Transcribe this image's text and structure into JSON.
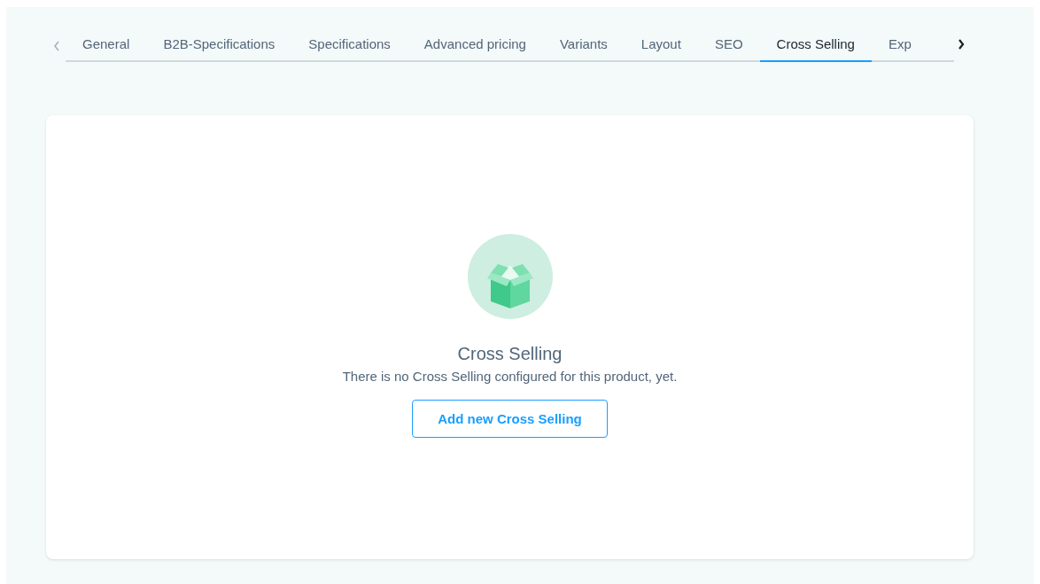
{
  "tabs": [
    {
      "label": "General",
      "selected": false
    },
    {
      "label": "B2B-Specifications",
      "selected": false
    },
    {
      "label": "Specifications",
      "selected": false
    },
    {
      "label": "Advanced pricing",
      "selected": false
    },
    {
      "label": "Variants",
      "selected": false
    },
    {
      "label": "Layout",
      "selected": false
    },
    {
      "label": "SEO",
      "selected": false
    },
    {
      "label": "Cross Selling",
      "selected": true
    },
    {
      "label": "Exp",
      "selected": false
    }
  ],
  "empty_state": {
    "title": "Cross Selling",
    "message": "There is no Cross Selling configured for this product, yet.",
    "button": "Add new Cross Selling"
  }
}
